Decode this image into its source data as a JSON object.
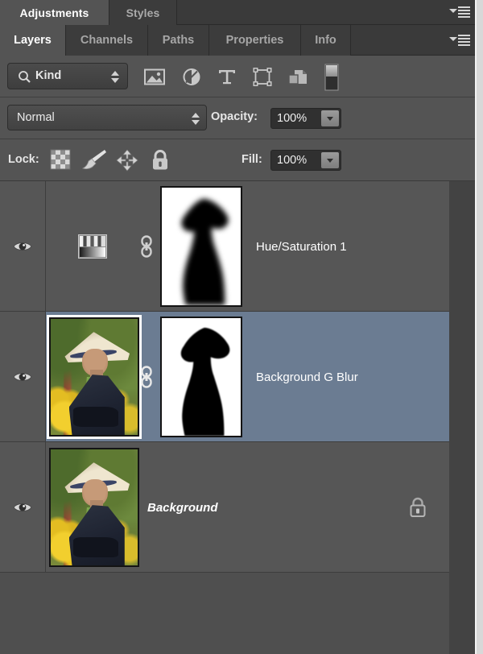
{
  "colors": {
    "panel_bg": "#545454",
    "tabbar_bg": "#3a3a3a",
    "row_unselected": "#565656",
    "row_selected": "#6b7c92",
    "text_primary": "#ffffff",
    "text_dim": "#a6a6a6",
    "field_bg": "#303030"
  },
  "dock": {
    "tabs": [
      {
        "label": "Adjustments",
        "active": true
      },
      {
        "label": "Styles",
        "active": false
      }
    ],
    "menu_icon": "panel-menu-icon"
  },
  "panel": {
    "tabs": [
      {
        "label": "Layers",
        "active": true
      },
      {
        "label": "Channels",
        "active": false
      },
      {
        "label": "Paths",
        "active": false
      },
      {
        "label": "Properties",
        "active": false
      },
      {
        "label": "Info",
        "active": false
      }
    ],
    "menu_icon": "panel-menu-icon"
  },
  "filter_row": {
    "kind_label": "Kind",
    "search_icon": "magnifier-icon",
    "filter_buttons": [
      {
        "name": "filter-pixel-layers",
        "icon": "image-icon"
      },
      {
        "name": "filter-adjustment-layers",
        "icon": "adjustment-half-circle-icon"
      },
      {
        "name": "filter-type-layers",
        "icon": "type-t-icon"
      },
      {
        "name": "filter-shape-layers",
        "icon": "shape-bounding-box-icon"
      },
      {
        "name": "filter-smart-objects",
        "icon": "smart-object-icon"
      }
    ],
    "toggle_name": "filter-enable-toggle"
  },
  "blend_row": {
    "blend_mode": "Normal",
    "opacity_label": "Opacity:",
    "opacity_value": "100%"
  },
  "lock_row": {
    "lock_label": "Lock:",
    "lock_buttons": [
      {
        "name": "lock-transparent-pixels",
        "icon": "checkerboard-icon"
      },
      {
        "name": "lock-image-pixels",
        "icon": "paintbrush-icon"
      },
      {
        "name": "lock-position",
        "icon": "move-arrows-icon"
      },
      {
        "name": "lock-all",
        "icon": "padlock-icon"
      }
    ],
    "fill_label": "Fill:",
    "fill_value": "100%"
  },
  "layers": [
    {
      "name": "Hue/Saturation 1",
      "visible": true,
      "selected": false,
      "italic": false,
      "thumb_type": "adjustment-gradient-icon",
      "has_mask": true,
      "mask_soft": true,
      "linked": true,
      "locked": false
    },
    {
      "name": "Background G Blur",
      "visible": true,
      "selected": true,
      "italic": false,
      "thumb_type": "photo",
      "has_mask": true,
      "mask_soft": false,
      "linked": true,
      "locked": false
    },
    {
      "name": "Background",
      "visible": true,
      "selected": false,
      "italic": true,
      "thumb_type": "photo",
      "has_mask": false,
      "mask_soft": false,
      "linked": false,
      "locked": true
    }
  ]
}
